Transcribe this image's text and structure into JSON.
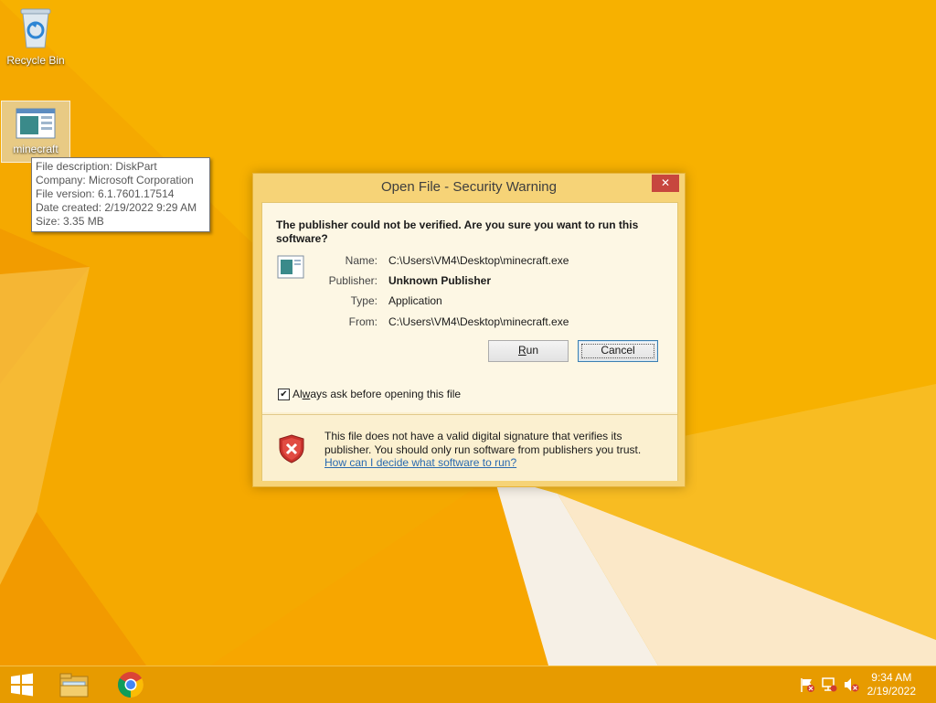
{
  "desktop": {
    "icons": [
      {
        "label": "Recycle Bin",
        "icon": "recycle-bin-icon"
      },
      {
        "label": "minecraft",
        "icon": "application-icon"
      }
    ]
  },
  "tooltip": {
    "lines": [
      "File description: DiskPart",
      "Company: Microsoft Corporation",
      "File version: 6.1.7601.17514",
      "Date created: 2/19/2022 9:29 AM",
      "Size: 3.35 MB"
    ]
  },
  "dialog": {
    "title": "Open File - Security Warning",
    "close_label": "✕",
    "headline": "The publisher could not be verified.  Are you sure you want to run this software?",
    "fields": [
      {
        "key": "Name:",
        "value": "C:\\Users\\VM4\\Desktop\\minecraft.exe",
        "bold": false
      },
      {
        "key": "Publisher:",
        "value": "Unknown Publisher",
        "bold": true
      },
      {
        "key": "Type:",
        "value": "Application",
        "bold": false
      },
      {
        "key": "From:",
        "value": "C:\\Users\\VM4\\Desktop\\minecraft.exe",
        "bold": false
      }
    ],
    "run_label_pre": "",
    "run_label_ul": "R",
    "run_label_post": "un",
    "cancel_label": "Cancel",
    "checkbox": {
      "checked": true,
      "label_pre": "Al",
      "label_ul": "w",
      "label_post": "ays ask before opening this file"
    },
    "warning_line1": "This file does not have a valid digital signature that verifies its",
    "warning_line2": "publisher.  You should only run software from publishers you trust.",
    "warning_link": "How can I decide what software to run?"
  },
  "taskbar": {
    "items": [
      {
        "icon": "windows-start-icon"
      },
      {
        "icon": "file-explorer-icon"
      },
      {
        "icon": "chrome-icon"
      }
    ],
    "tray": [
      "action-center-flag-icon",
      "network-icon",
      "volume-muted-icon"
    ],
    "time": "9:34 AM",
    "date": "2/19/2022"
  },
  "colors": {
    "wallpaper": "#f2a400",
    "dialog_frame": "#f6d377",
    "close_button": "#c7463e",
    "link": "#2a6ab0"
  }
}
